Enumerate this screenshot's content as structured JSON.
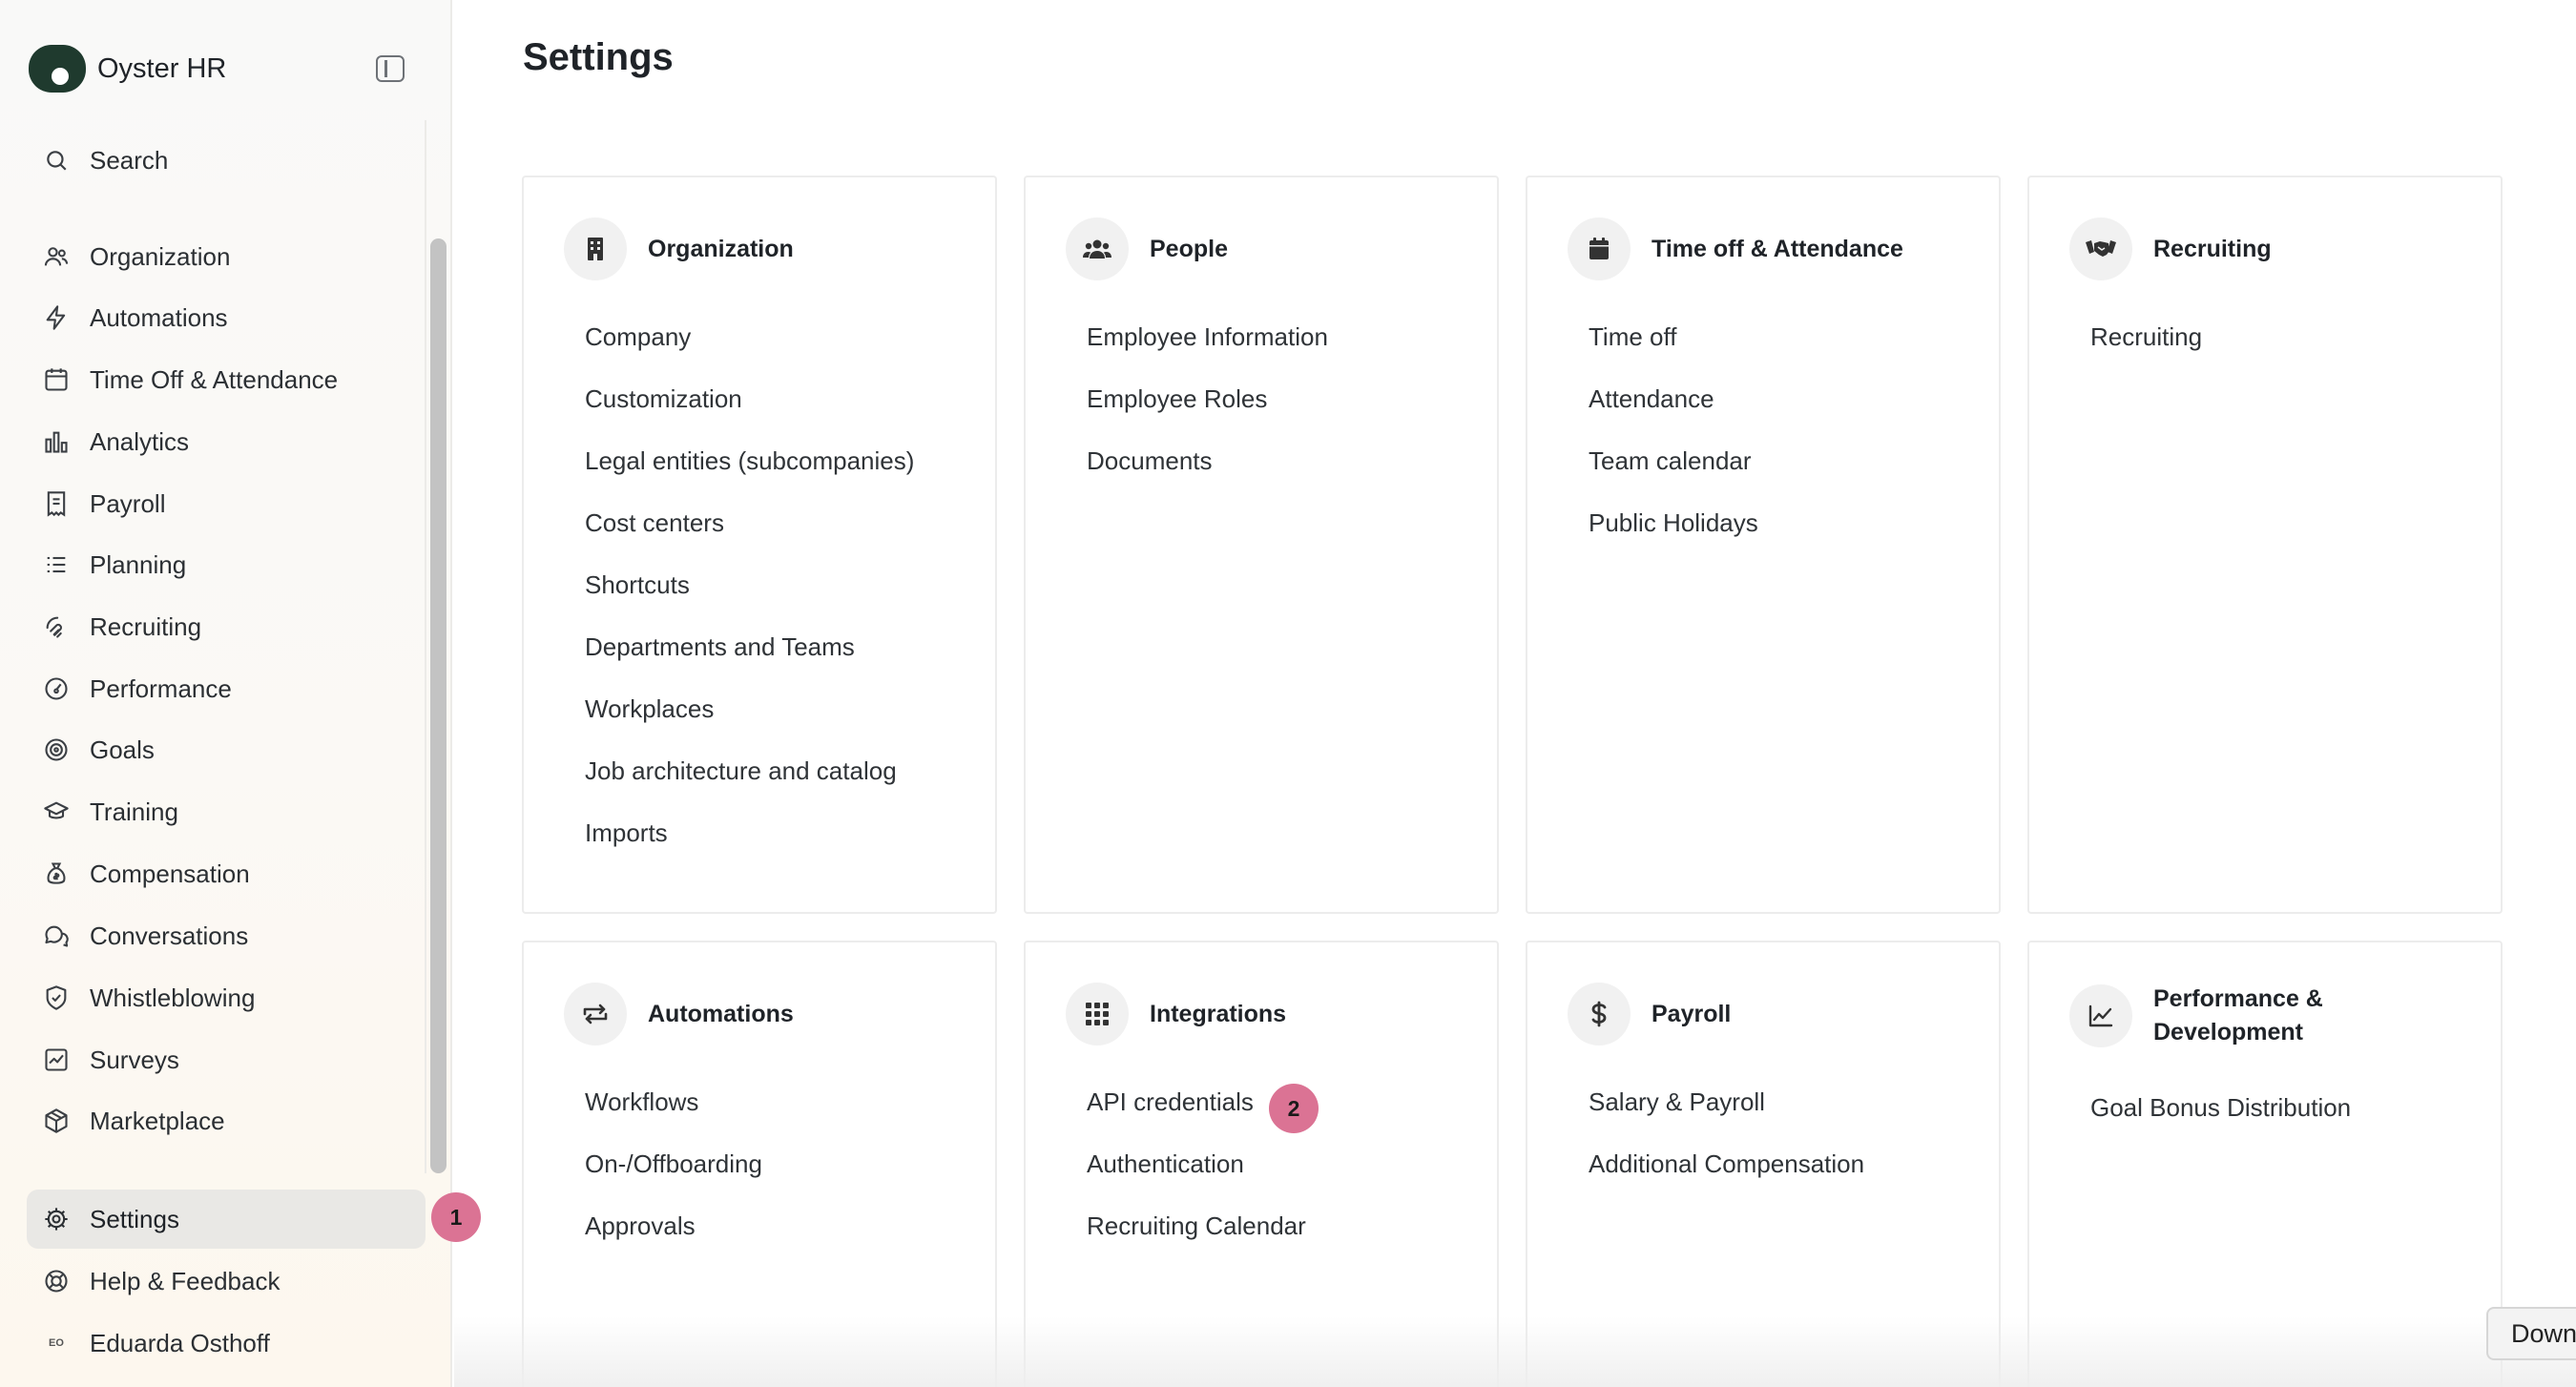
{
  "brand": {
    "name": "Oyster HR"
  },
  "sidebar": {
    "search_label": "Search",
    "items": [
      {
        "label": "Organization",
        "icon": "users-group-icon"
      },
      {
        "label": "Automations",
        "icon": "lightning-icon"
      },
      {
        "label": "Time Off & Attendance",
        "icon": "calendar-icon"
      },
      {
        "label": "Analytics",
        "icon": "bar-chart-icon"
      },
      {
        "label": "Payroll",
        "icon": "receipt-icon"
      },
      {
        "label": "Planning",
        "icon": "list-icon"
      },
      {
        "label": "Recruiting",
        "icon": "handshake-icon"
      },
      {
        "label": "Performance",
        "icon": "gauge-icon"
      },
      {
        "label": "Goals",
        "icon": "target-icon"
      },
      {
        "label": "Training",
        "icon": "graduation-cap-icon"
      },
      {
        "label": "Compensation",
        "icon": "money-bag-icon"
      },
      {
        "label": "Conversations",
        "icon": "chat-bubbles-icon"
      },
      {
        "label": "Whistleblowing",
        "icon": "shield-check-icon"
      },
      {
        "label": "Surveys",
        "icon": "survey-chart-icon"
      },
      {
        "label": "Marketplace",
        "icon": "package-icon"
      }
    ],
    "settings_label": "Settings",
    "help_label": "Help & Feedback",
    "user_name": "Eduarda Osthoff",
    "user_initials": "EO"
  },
  "badges": {
    "settings": "1",
    "api_credentials": "2"
  },
  "page": {
    "title": "Settings"
  },
  "cards": [
    {
      "title": "Organization",
      "icon": "building-icon",
      "links": [
        "Company",
        "Customization",
        "Legal entities (subcompanies)",
        "Cost centers",
        "Shortcuts",
        "Departments and Teams",
        "Workplaces",
        "Job architecture and catalog",
        "Imports"
      ]
    },
    {
      "title": "People",
      "icon": "people-icon",
      "links": [
        "Employee Information",
        "Employee Roles",
        "Documents"
      ]
    },
    {
      "title": "Time off & Attendance",
      "icon": "calendar-icon",
      "links": [
        "Time off",
        "Attendance",
        "Team calendar",
        "Public Holidays"
      ]
    },
    {
      "title": "Recruiting",
      "icon": "handshake-icon",
      "links": [
        "Recruiting"
      ]
    },
    {
      "title": "Automations",
      "icon": "repeat-icon",
      "links": [
        "Workflows",
        "On-/Offboarding",
        "Approvals"
      ]
    },
    {
      "title": "Integrations",
      "icon": "grid-icon",
      "links": [
        "API credentials",
        "Authentication",
        "Recruiting Calendar"
      ]
    },
    {
      "title": "Payroll",
      "icon": "dollar-icon",
      "links": [
        "Salary & Payroll",
        "Additional Compensation"
      ]
    },
    {
      "title": "Performance & Development",
      "icon": "trend-chart-icon",
      "links": [
        "Goal Bonus Distribution"
      ]
    }
  ],
  "download_label": "Down",
  "colors": {
    "badge": "#db7394",
    "logo": "#1f3a2e",
    "active_item_bg": "#e9e8e5"
  }
}
